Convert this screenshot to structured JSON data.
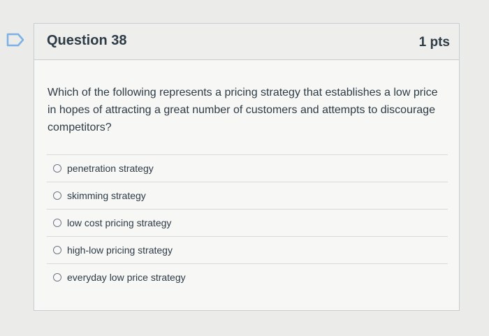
{
  "question": {
    "title": "Question 38",
    "points": "1 pts",
    "text": "Which of the following represents a pricing strategy that establishes a low price in hopes of attracting a great number of customers and attempts to discourage competitors?",
    "answers": [
      {
        "label": "penetration strategy"
      },
      {
        "label": "skimming strategy"
      },
      {
        "label": "low cost pricing strategy"
      },
      {
        "label": "high-low pricing strategy"
      },
      {
        "label": "everyday low price strategy"
      }
    ]
  },
  "colors": {
    "flag": "#7db0e6",
    "text": "#2d3b45"
  }
}
